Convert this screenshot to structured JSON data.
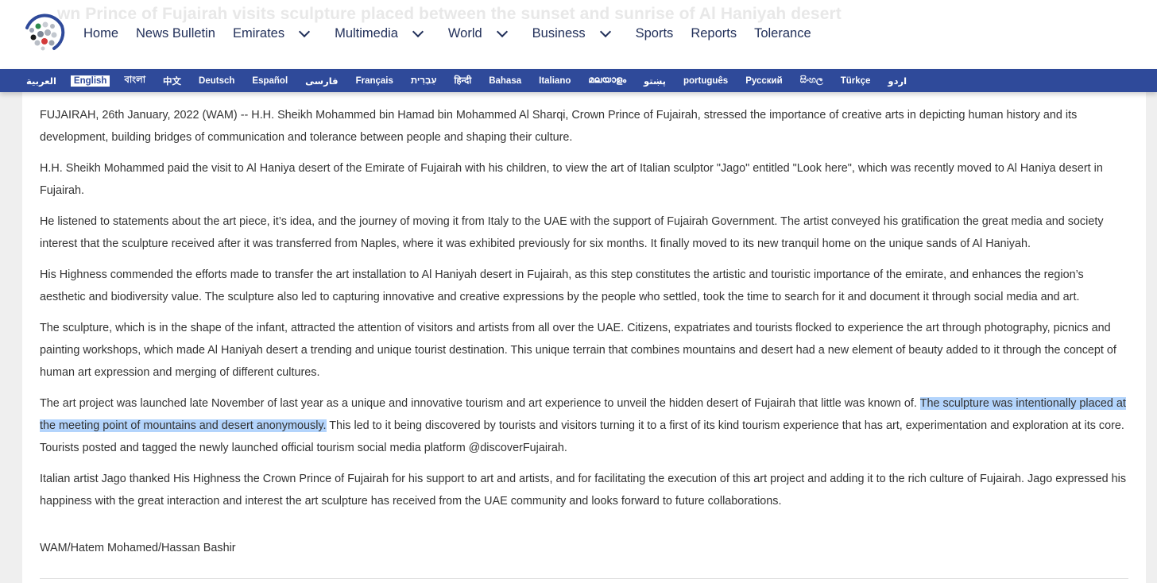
{
  "header": {
    "ghost_title": "wn Prince of Fujairah visits sculpture placed between the sunset and sunrise of Al Haniyah desert",
    "nav": [
      {
        "label": "Home"
      },
      {
        "label": "News Bulletin"
      },
      {
        "label": "Emirates"
      },
      {
        "label": "Multimedia"
      },
      {
        "label": "World"
      },
      {
        "label": "Business"
      },
      {
        "label": "Sports"
      },
      {
        "label": "Reports"
      },
      {
        "label": "Tolerance"
      }
    ]
  },
  "languages": [
    "العربية",
    "English",
    "বাংলা",
    "中文",
    "Deutsch",
    "Español",
    "فارسی",
    "Français",
    "עִבְרִית",
    "हिन्दी",
    "Bahasa",
    "Italiano",
    "മലയാളം",
    "پښتو",
    "português",
    "Русский",
    "සිංහල",
    "Türkçe",
    "اردو"
  ],
  "active_language": "English",
  "article": {
    "p1": "FUJAIRAH, 26th January, 2022 (WAM) -- H.H. Sheikh Mohammed bin Hamad bin Mohammed Al Sharqi, Crown Prince of Fujairah, stressed the importance of creative arts in depicting human history and its development, building bridges of communication and tolerance between people and shaping their culture.",
    "p2": "H.H. Sheikh Mohammed paid the visit to Al Haniya desert of the Emirate of Fujairah with his children, to view the art of Italian sculptor \"Jago\" entitled \"Look here\", which was recently moved to Al Haniya desert in Fujairah.",
    "p3": "He listened to statements about the art piece, it’s idea, and the journey of moving it from Italy to the UAE with the support of Fujairah Government. The artist conveyed his gratification the great media and society interest that the sculpture received after it was transferred from Naples, where it was exhibited previously for six months. It finally moved to its new tranquil home on the unique sands of Al Haniyah.",
    "p4": "His Highness commended the efforts made to transfer the art installation to Al Haniyah desert in Fujairah, as this step constitutes the artistic and touristic importance of the emirate, and enhances the region’s aesthetic and biodiversity value. The sculpture also led to capturing innovative and creative expressions by the people who settled, took the time to search for it and document it through social media and art.",
    "p5": "The sculpture, which is in the shape of the infant, attracted the attention of visitors and artists from all over the UAE. Citizens, expatriates and tourists flocked to experience the art through photography, picnics and painting workshops, which made Al Haniyah desert a trending and unique tourist destination. This unique terrain that combines mountains and desert had a new element of beauty added to it through the concept of human art expression and merging of different cultures.",
    "p6_before": "The art project was launched late November of last year as a unique and innovative tourism and art experience to unveil the hidden desert of Fujairah that little was known of. ",
    "p6_selected": "The sculpture was intentionally placed at the meeting point of mountains and desert anonymously.",
    "p6_after": " This led to it being discovered by tourists and visitors turning it to a first of its kind tourism experience that has art, experimentation and exploration at its core. Tourists posted and tagged the newly launched official tourism social media platform @discoverFujairah.",
    "p7": "Italian artist Jago thanked His Highness the Crown Prince of Fujairah for his support to art and artists, and for facilitating the execution of this art project and adding it to the rich culture of Fujairah. Jago expressed his happiness with the great interaction and interest the art sculpture has received from the UAE community and looks forward to future collaborations.",
    "credit": "WAM/Hatem Mohamed/Hassan Bashir"
  },
  "colors": {
    "nav_text": "#22305a",
    "language_bar": "#2f4a9a",
    "selection": "#b3d4fc"
  },
  "icons": {
    "logo": "globe-dots-logo",
    "dropdown": "chevron-down-icon"
  }
}
